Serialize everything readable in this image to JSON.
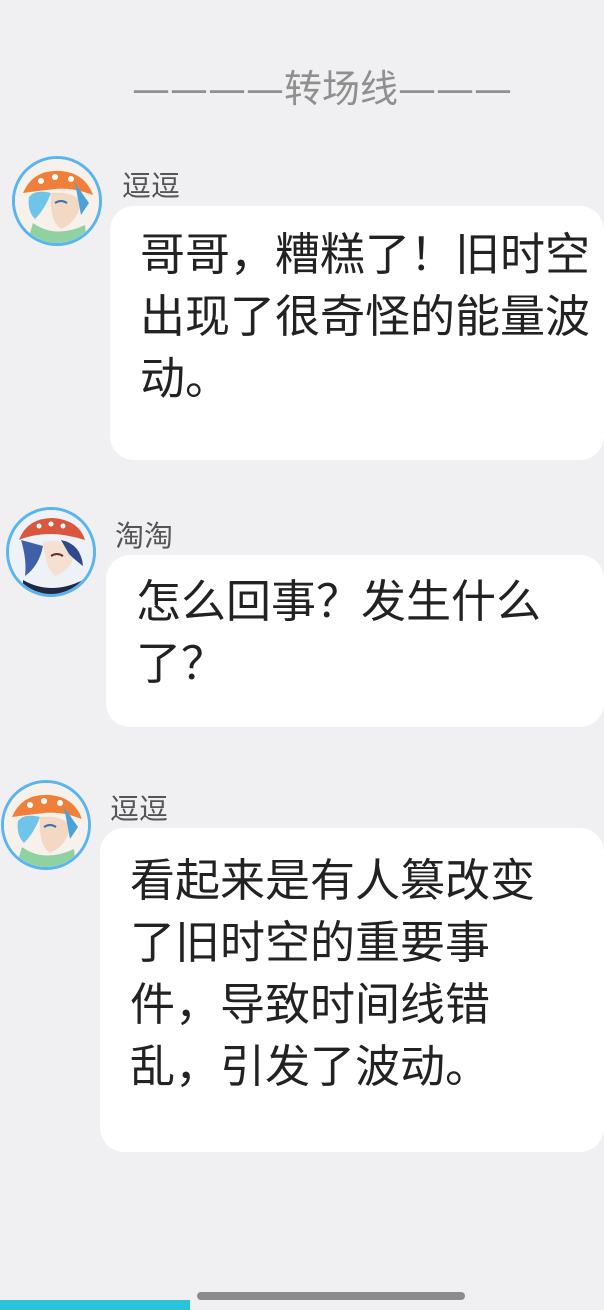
{
  "divider": {
    "text": "————转场线———"
  },
  "messages": [
    {
      "sender": "逗逗",
      "avatar_icon": "avatar-doudou-icon",
      "text": "哥哥，糟糕了！旧时空出现了很奇怪的能量波动。"
    },
    {
      "sender": "淘淘",
      "avatar_icon": "avatar-taotao-icon",
      "text": "怎么回事？发生什么了？"
    },
    {
      "sender": "逗逗",
      "avatar_icon": "avatar-doudou-icon",
      "text": "看起来是有人篡改变了旧时空的重要事件，导致时间线错乱，引发了波动。"
    }
  ],
  "colors": {
    "background": "#f0f0f2",
    "bubble": "#ffffff",
    "avatar_ring": "#5ab4ef",
    "home_indicator": "#8b8b8b",
    "corner_strip": "#29c4dc"
  }
}
